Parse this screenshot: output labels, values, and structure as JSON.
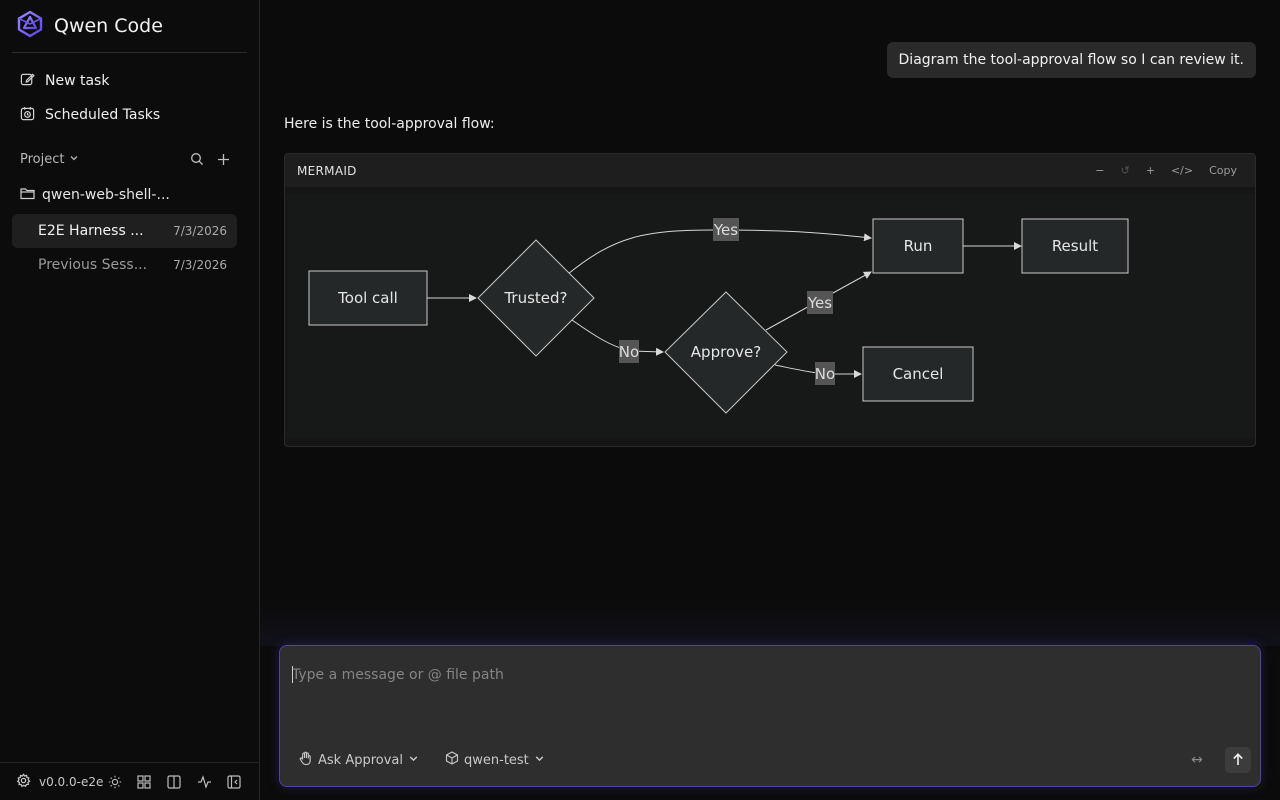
{
  "app": {
    "title": "Qwen Code"
  },
  "sidebar": {
    "nav": [
      {
        "label": "New task",
        "icon": "edit-icon"
      },
      {
        "label": "Scheduled Tasks",
        "icon": "scheduled-clock-icon"
      }
    ],
    "project_label": "Project",
    "folder": "qwen-web-shell-...",
    "sessions": [
      {
        "title": "E2E Harness ...",
        "date": "7/3/2026",
        "active": true
      },
      {
        "title": "Previous Sess...",
        "date": "7/3/2026",
        "active": false
      }
    ],
    "version": "v0.0.0-e2e"
  },
  "chat": {
    "user_message": "Diagram the tool-approval flow so I can review it.",
    "assistant_text": "Here is the tool-approval flow:",
    "code_block": {
      "language": "MERMAID",
      "tools": [
        "−",
        "↺",
        "+",
        "</>",
        "Copy"
      ]
    },
    "diagram": {
      "nodes": {
        "tool_call": "Tool call",
        "trusted": "Trusted?",
        "approve": "Approve?",
        "run": "Run",
        "result": "Result",
        "cancel": "Cancel"
      },
      "edge_labels": {
        "trusted_yes": "Yes",
        "trusted_no": "No",
        "approve_yes": "Yes",
        "approve_no": "No"
      }
    }
  },
  "composer": {
    "placeholder": "Type a message or @ file path",
    "approval_mode": "Ask Approval",
    "model": "qwen-test",
    "expand_symbol": "↔"
  },
  "colors": {
    "accent": "#7c6cf0",
    "background": "#0b0b0b",
    "node_fill": "#252828"
  }
}
